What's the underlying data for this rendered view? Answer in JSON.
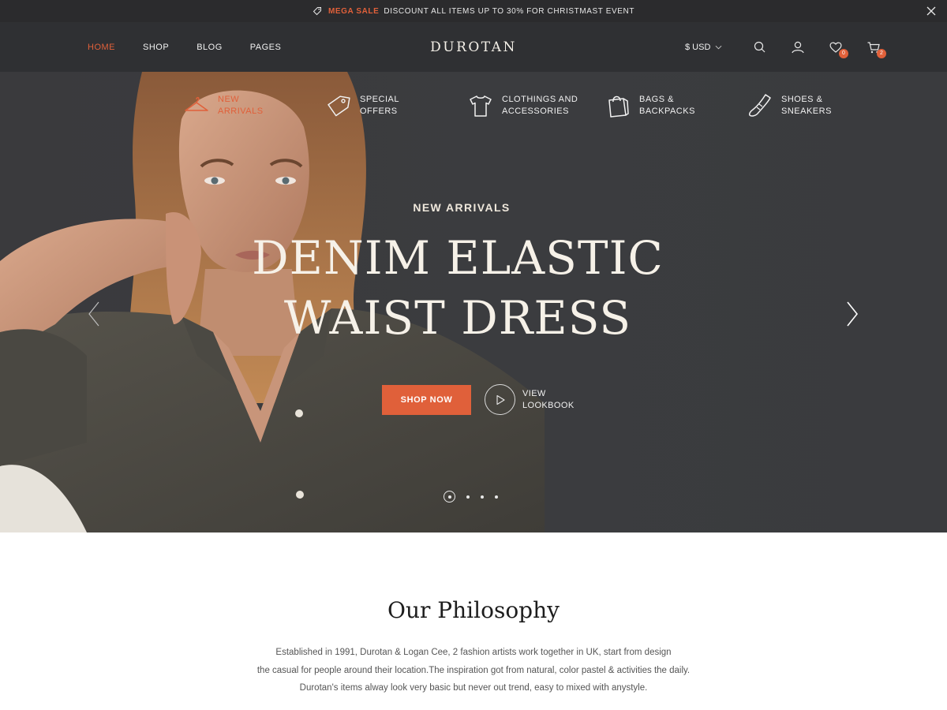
{
  "announcement": {
    "sale_label": "MEGA SALE",
    "message": "DISCOUNT ALL ITEMS UP TO 30% FOR CHRISTMAST EVENT",
    "icons": [
      "tag-icon",
      "close-icon"
    ]
  },
  "header": {
    "nav": [
      {
        "label": "HOME",
        "active": true
      },
      {
        "label": "SHOP",
        "active": false
      },
      {
        "label": "BLOG",
        "active": false
      },
      {
        "label": "PAGES",
        "active": false
      }
    ],
    "logo": "DUROTAN",
    "currency": "$ USD",
    "icons": [
      "search-icon",
      "user-icon",
      "heart-icon",
      "cart-icon"
    ],
    "wishlist_count": "0",
    "cart_count": "2"
  },
  "hero": {
    "categories": [
      {
        "line1": "NEW",
        "line2": "ARRIVALS",
        "icon": "hanger-icon",
        "active": true
      },
      {
        "line1": "SPECIAL",
        "line2": "OFFERS",
        "icon": "price-tag-icon",
        "active": false
      },
      {
        "line1": "CLOTHINGS AND",
        "line2": "ACCESSORIES",
        "icon": "tshirt-icon",
        "active": false
      },
      {
        "line1": "BAGS &",
        "line2": "BACKPACKS",
        "icon": "shopping-bag-icon",
        "active": false
      },
      {
        "line1": "SHOES &",
        "line2": "SNEAKERS",
        "icon": "sneaker-icon",
        "active": false
      }
    ],
    "eyebrow": "NEW ARRIVALS",
    "headline_line1": "DENIM ELASTIC",
    "headline_line2": "WAIST DRESS",
    "cta": "SHOP NOW",
    "lookbook_line1": "VIEW",
    "lookbook_line2": "LOOKBOOK",
    "slide_count": 4,
    "active_slide": 1
  },
  "philosophy": {
    "title": "Our Philosophy",
    "line1": "Established in 1991, Durotan & Logan Cee, 2 fashion artists work together in UK, start from design",
    "line2": "the casual for people around their location.The inspiration got from natural, color pastel & activities the daily.",
    "line3": "Durotan's items alway look very basic but never out trend, easy to mixed with anystyle."
  },
  "colors": {
    "accent": "#e0603a",
    "header_bg": "#2f3033",
    "topbar_bg": "#2b2b2d",
    "hero_bg": "#3b3c3f"
  }
}
